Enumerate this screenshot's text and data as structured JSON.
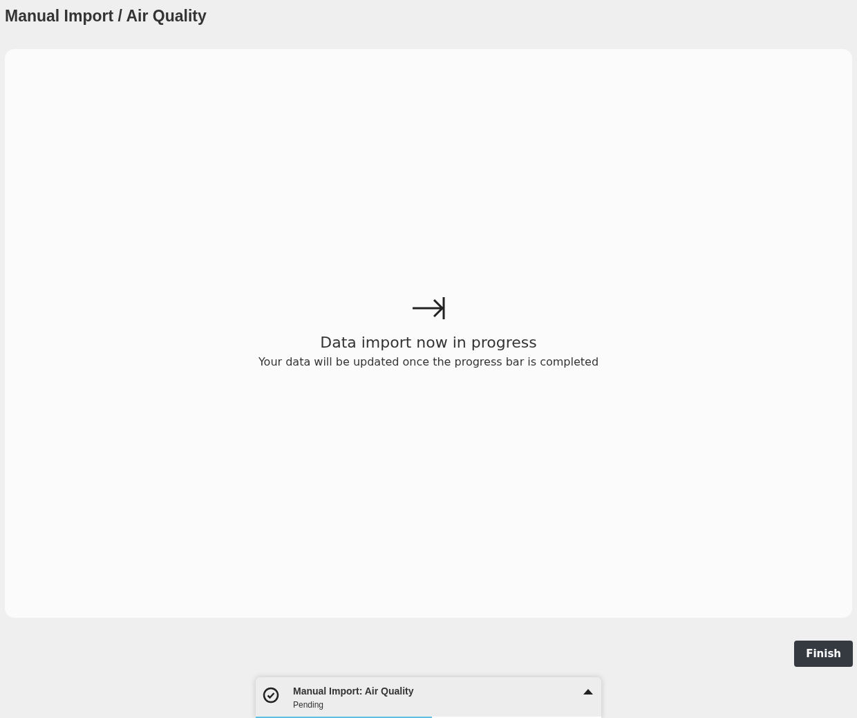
{
  "page": {
    "title": "Manual Import / Air Quality"
  },
  "status": {
    "heading": "Data import now in progress",
    "message": "Your data will be updated once the progress bar is completed"
  },
  "buttons": [
    {
      "label": "Finish"
    }
  ],
  "notification": {
    "title": "Manual Import: Air Quality",
    "state": "Pending",
    "expanded": true,
    "level": 0.51
  }
}
